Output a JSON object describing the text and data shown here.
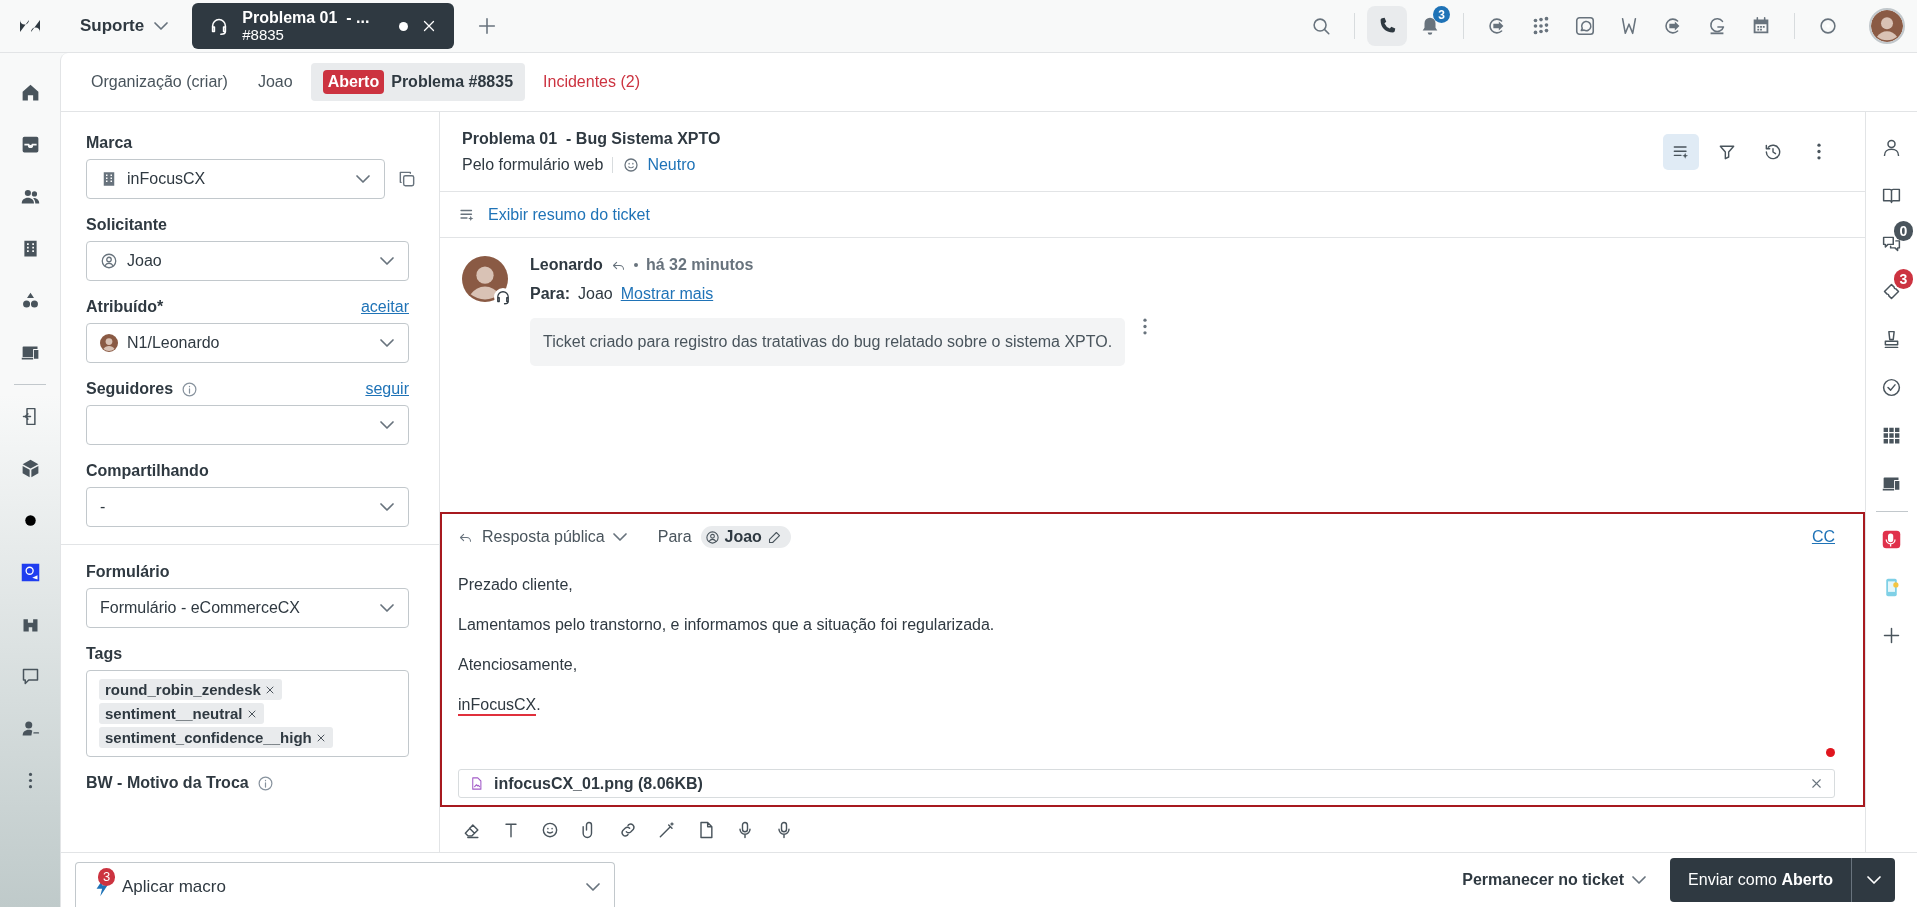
{
  "topbar": {
    "workspace": "Suporte",
    "tab": {
      "title": "Problema 01  - ...",
      "number": "#8835",
      "unsaved": true
    },
    "call_active": true,
    "notifications": "3"
  },
  "ticket_tabs": [
    {
      "label": "Organização (criar)",
      "kind": "plain",
      "selected": false
    },
    {
      "label": "Joao",
      "kind": "plain",
      "selected": false
    },
    {
      "label": "Problema #8835",
      "status": "Aberto",
      "kind": "ticket",
      "selected": true
    },
    {
      "label": "Incidentes (2)",
      "kind": "alert",
      "selected": false
    }
  ],
  "fields": [
    {
      "label": "Marca",
      "kind": "brand",
      "value": "inFocusCX",
      "info": false,
      "divider_before": false
    },
    {
      "label": "Solicitante",
      "kind": "requester",
      "value": "Joao",
      "info": false,
      "divider_before": false
    },
    {
      "label": "Atribuído*",
      "kind": "assignee",
      "value": "N1/Leonardo",
      "link": "aceitar",
      "info": false,
      "divider_before": false
    },
    {
      "label": "Seguidores",
      "kind": "select",
      "link": "seguir",
      "info": true,
      "divider_before": false
    },
    {
      "label": "Compartilhando",
      "kind": "select",
      "value": "-",
      "info": false,
      "divider_before": false
    },
    {
      "label": "Formulário",
      "kind": "select",
      "value": "Formulário - eCommerceCX",
      "info": false,
      "divider_before": true
    },
    {
      "label": "Tags",
      "kind": "tags",
      "tags": [
        "round_robin_zendesk",
        "sentiment__neutral",
        "sentiment_confidence__high"
      ],
      "info": false,
      "divider_before": false
    },
    {
      "label": "BW - Motivo da Troca",
      "kind": "heading",
      "info": true,
      "divider_before": false
    }
  ],
  "ticket": {
    "title": "Problema 01  - Bug Sistema XPTO",
    "channel": "Pelo formulário web",
    "sentiment": "Neutro",
    "summary_link": "Exibir resumo do ticket"
  },
  "header_tools": [
    {
      "selected": true
    },
    {
      "selected": false
    },
    {
      "selected": false
    },
    {
      "selected": false
    }
  ],
  "message": {
    "author": "Leonardo",
    "time": "há 32 minutos",
    "to_label": "Para:",
    "to": "Joao",
    "more": "Mostrar mais",
    "body": "Ticket criado para registro das tratativas do bug relatado sobre o sistema XPTO."
  },
  "composer": {
    "mode": "Resposta pública",
    "to_label": "Para",
    "recipient": "Joao",
    "cc": "CC",
    "paragraphs": [
      [
        {
          "text": "Prezado cliente,",
          "misspelled": false
        }
      ],
      [
        {
          "text": "Lamentamos pelo transtorno, e informamos que a situação foi regularizada.",
          "misspelled": false
        }
      ],
      [
        {
          "text": "Atenciosamente,",
          "misspelled": false
        }
      ],
      [
        {
          "text": "inFocusCX",
          "misspelled": true
        },
        {
          "text": ".",
          "misspelled": false
        }
      ]
    ],
    "attachment": "infocusCX_01.png (8.06KB)"
  },
  "right_rail": {
    "badges": [
      {
        "count": "0",
        "color": "#49545c"
      },
      {
        "count": "3",
        "color": "#cc3340"
      }
    ]
  },
  "footer": {
    "macro": "Aplicar macro",
    "macro_badge": "3",
    "stay": "Permanecer no ticket",
    "send": "Enviar como **Aberto**"
  }
}
